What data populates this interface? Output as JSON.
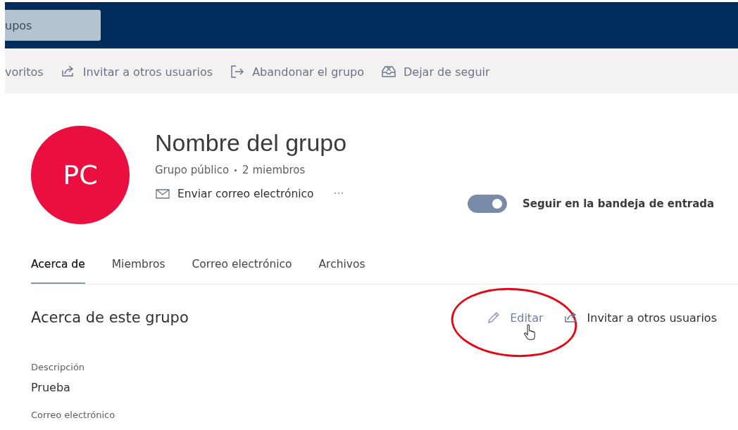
{
  "top_bar": {
    "search": {
      "value": "upos"
    }
  },
  "toolbar": [
    {
      "kind": "text",
      "label": "voritos"
    },
    {
      "kind": "share",
      "label": "Invitar a otros usuarios"
    },
    {
      "kind": "leave",
      "label": "Abandonar el grupo"
    },
    {
      "kind": "inbox",
      "label": "Dejar de seguir"
    }
  ],
  "group": {
    "initials": "PC",
    "name": "Nombre del grupo",
    "privacy": "Grupo público",
    "members": "2 miembros",
    "send_email": "Enviar correo electrónico",
    "more": "···"
  },
  "follow": {
    "on": true,
    "label": "Seguir en la bandeja de entrada"
  },
  "tabs": [
    {
      "label": "Acerca de",
      "selected": true
    },
    {
      "label": "Miembros",
      "selected": false
    },
    {
      "label": "Correo electrónico",
      "selected": false
    },
    {
      "label": "Archivos",
      "selected": false
    }
  ],
  "about": {
    "title": "Acerca de este grupo",
    "actions": [
      {
        "kind": "edit",
        "label": "Editar",
        "hovered": true
      },
      {
        "kind": "share",
        "label": "Invitar a otros usuarios",
        "hovered": false
      }
    ],
    "fields": [
      {
        "label": "Descripción",
        "value": "Prueba"
      },
      {
        "label": "Correo electrónico"
      }
    ]
  }
}
